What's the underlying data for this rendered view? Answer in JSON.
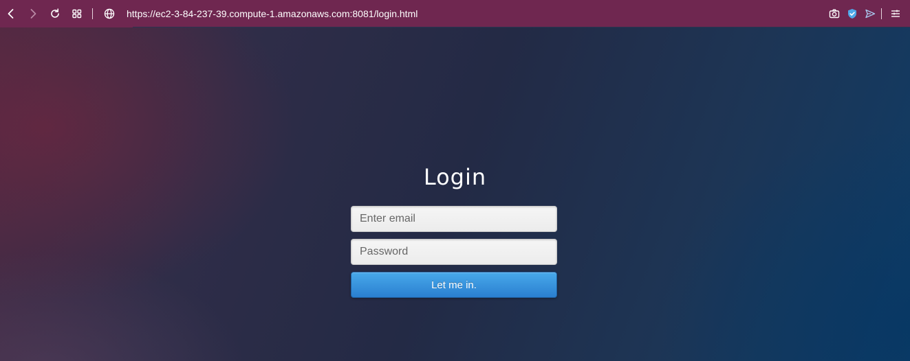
{
  "browser": {
    "url": "https://ec2-3-84-237-39.compute-1.amazonaws.com:8081/login.html",
    "bar_color": "#6f2750",
    "icons": {
      "back": "back-arrow-icon",
      "forward": "forward-arrow-icon",
      "reload": "reload-icon",
      "tabs": "tab-grid-icon",
      "site": "globe-icon",
      "screenshot": "camera-icon",
      "shield": "shield-check-icon",
      "send": "send-icon",
      "menu": "menu-icon"
    }
  },
  "login": {
    "title": "Login",
    "email_placeholder": "Enter email",
    "email_value": "",
    "password_placeholder": "Password",
    "password_value": "",
    "submit_label": "Let me in.",
    "submit_color": "#3a94e0"
  }
}
